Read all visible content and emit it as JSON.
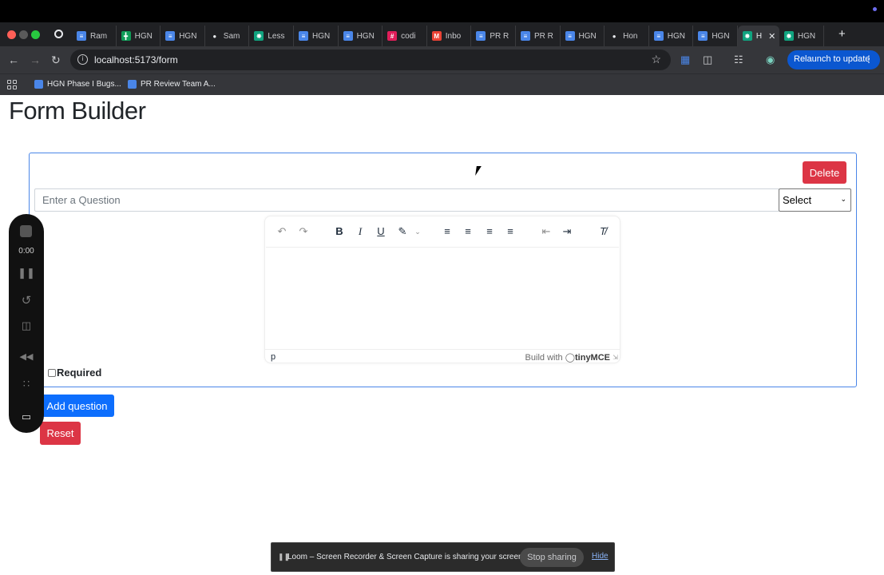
{
  "browser": {
    "tabs": [
      {
        "label": "Ram",
        "icon": "docs-icon",
        "color": "#4a86e8"
      },
      {
        "label": "HGN",
        "icon": "sheets-icon",
        "color": "#0f9d58"
      },
      {
        "label": "HGN",
        "icon": "docs-icon",
        "color": "#4a86e8"
      },
      {
        "label": "Sam",
        "icon": "github-icon",
        "color": "#e8eaed"
      },
      {
        "label": "Less",
        "icon": "chatgpt-icon",
        "color": "#10a37f"
      },
      {
        "label": "HGN",
        "icon": "docs-icon",
        "color": "#4a86e8"
      },
      {
        "label": "HGN",
        "icon": "docs-icon",
        "color": "#4a86e8"
      },
      {
        "label": "codi",
        "icon": "slack-icon",
        "color": "#e01e5a"
      },
      {
        "label": "Inbo",
        "icon": "gmail-icon",
        "color": "#ea4335"
      },
      {
        "label": "PR R",
        "icon": "docs-icon",
        "color": "#4a86e8"
      },
      {
        "label": "PR R",
        "icon": "docs-icon",
        "color": "#4a86e8"
      },
      {
        "label": "HGN",
        "icon": "docs-icon",
        "color": "#4a86e8"
      },
      {
        "label": "Hon",
        "icon": "github-icon",
        "color": "#e8eaed"
      },
      {
        "label": "HGN",
        "icon": "docs-icon",
        "color": "#4a86e8"
      },
      {
        "label": "HGN",
        "icon": "docs-icon",
        "color": "#4a86e8"
      },
      {
        "label": "H",
        "icon": "chatgpt-icon",
        "color": "#10a37f",
        "active": true
      },
      {
        "label": "HGN",
        "icon": "chatgpt-icon",
        "color": "#10a37f"
      }
    ],
    "url": "localhost:5173/form",
    "relaunch_label": "Relaunch to update",
    "bookmarks": [
      "HGN Phase I Bugs...",
      "PR Review Team A..."
    ]
  },
  "page": {
    "title": "Form Builder",
    "delete_label": "Delete",
    "question_placeholder": "Enter a Question",
    "select_value": "Select",
    "editor": {
      "status_path": "p",
      "build_with": "Build with",
      "brand": "tinyMCE"
    },
    "required_label": "Required",
    "add_question_label": "Add question",
    "reset_label": "Reset"
  },
  "loom": {
    "timer": "0:00"
  },
  "share_banner": {
    "message": "Loom – Screen Recorder & Screen Capture is sharing your screen.",
    "stop_label": "Stop sharing",
    "hide_label": "Hide"
  },
  "colors": {
    "primary": "#0d6efd",
    "danger": "#dc3545",
    "card_border": "#4a86e8"
  }
}
